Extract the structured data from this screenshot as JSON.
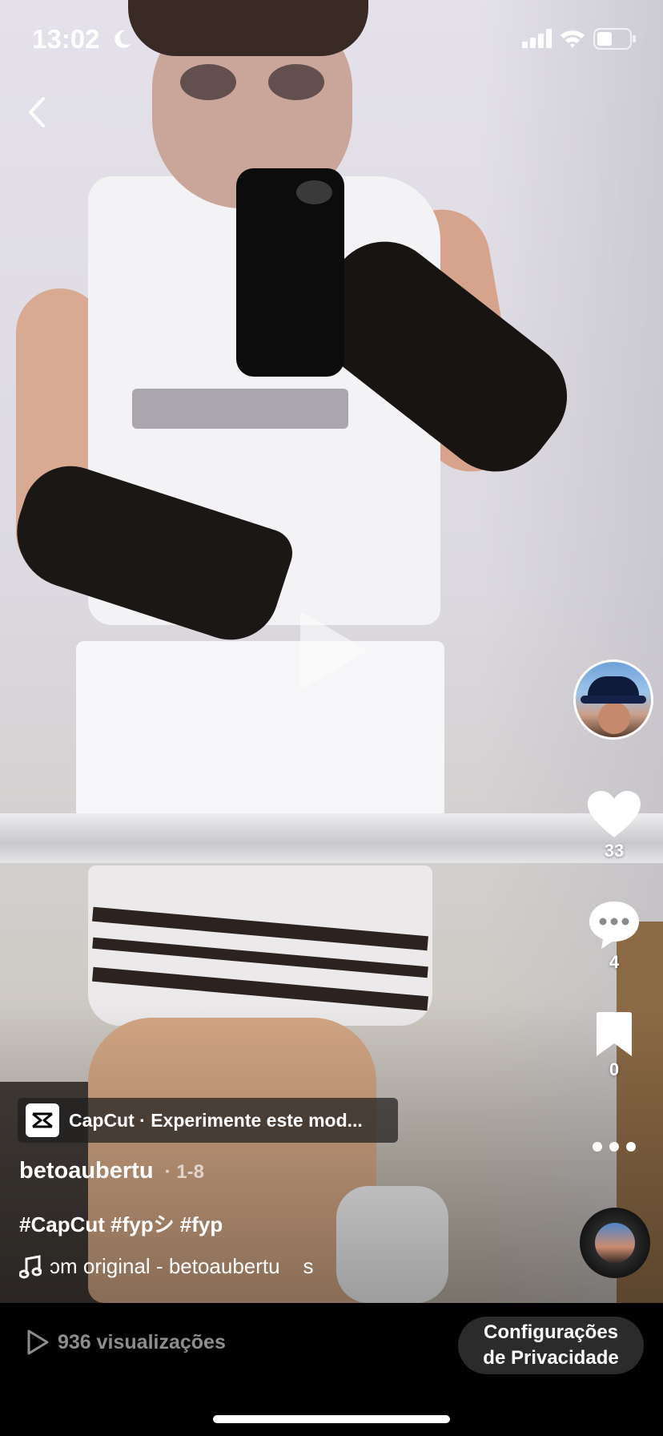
{
  "status_bar": {
    "time": "13:02",
    "icons": [
      "moon-icon",
      "signal-icon",
      "wifi-icon",
      "battery-icon"
    ]
  },
  "video": {
    "play_icon": "play-icon"
  },
  "rail": {
    "likes": "33",
    "comments": "4",
    "saves": "0"
  },
  "capcut": {
    "label": "CapCut · Experimente este mod..."
  },
  "post": {
    "username": "betoaubertu",
    "date": "· 1-8",
    "caption": "#CapCut #fypシ #fyp",
    "sound": "ɔm original - betoaubertu    s"
  },
  "bottom": {
    "views": "936 visualizações",
    "privacy_line1": "Configurações",
    "privacy_line2": "de Privacidade"
  },
  "colors": {
    "background": "#000000",
    "chip_bg": "#1e1e1e",
    "muted_text": "#8d8d8d"
  }
}
